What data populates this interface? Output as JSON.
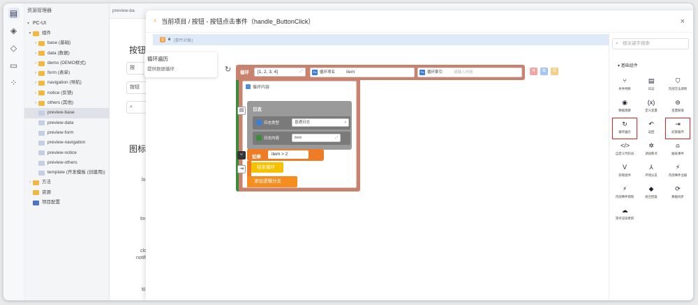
{
  "explorer": {
    "title": "资源管理器",
    "project": "PC-UI",
    "tree": [
      {
        "label": "组件",
        "type": "folder",
        "arrow": "▾",
        "indent": 1
      },
      {
        "label": "base (基础)",
        "type": "folder",
        "arrow": "›",
        "indent": 2
      },
      {
        "label": "data (数据)",
        "type": "folder",
        "arrow": "›",
        "indent": 2
      },
      {
        "label": "demo (DEMO样式)",
        "type": "folder",
        "arrow": "›",
        "indent": 2
      },
      {
        "label": "form (表单)",
        "type": "folder",
        "arrow": "›",
        "indent": 2
      },
      {
        "label": "navigation (导航)",
        "type": "folder",
        "arrow": "›",
        "indent": 2
      },
      {
        "label": "notice (反馈)",
        "type": "folder",
        "arrow": "›",
        "indent": 2
      },
      {
        "label": "others (其他)",
        "type": "folder",
        "arrow": "›",
        "indent": 2
      },
      {
        "label": "preview-base",
        "type": "file",
        "arrow": "",
        "indent": 2,
        "selected": true
      },
      {
        "label": "preview-data",
        "type": "file",
        "arrow": "",
        "indent": 2
      },
      {
        "label": "preview-form",
        "type": "file",
        "arrow": "",
        "indent": 2
      },
      {
        "label": "preview-navigation",
        "type": "file",
        "arrow": "",
        "indent": 2
      },
      {
        "label": "preview-notice",
        "type": "file",
        "arrow": "",
        "indent": 2
      },
      {
        "label": "preview-others",
        "type": "file",
        "arrow": "",
        "indent": 2
      },
      {
        "label": "template (开发模板 (创建用))",
        "type": "file",
        "arrow": "",
        "indent": 2
      },
      {
        "label": "方法",
        "type": "folder",
        "arrow": "›",
        "indent": 1
      },
      {
        "label": "资源",
        "type": "folder",
        "arrow": "",
        "indent": 1
      },
      {
        "label": "项目配置",
        "type": "cfg",
        "arrow": "",
        "indent": 1
      }
    ]
  },
  "editor": {
    "tab": "preview-ba",
    "heading1": "按钮",
    "box1": "按",
    "box2": "按钮",
    "heading2": "图标",
    "items": [
      "lo",
      "tin",
      "clo",
      "notifi",
      "fil"
    ]
  },
  "modal": {
    "title": "当前项目 / 按钮 - 按钮点击事件（handle_ButtonClick）",
    "close": "×",
    "param": {
      "icon": "{}",
      "name": "e",
      "desc": "(事件对象)"
    }
  },
  "tooltip": {
    "title": "循环遍历",
    "desc": "提供数据循环"
  },
  "loop": {
    "label": "循环",
    "array_value": "[1, 2, 3, 4]",
    "item_label": "循环项名",
    "item_value": "item",
    "index_label": "循环索引",
    "index_placeholder": "请输入内容",
    "body_title": "循环内容"
  },
  "log": {
    "label": "日志",
    "type_label": "日志类型",
    "type_value": "普通日志",
    "content_label": "日志内容",
    "content_value": "item"
  },
  "if_block": {
    "label": "如果",
    "condition": "item > 2",
    "break_label": "结束循环",
    "add_branch": "添加逻辑分支"
  },
  "panel": {
    "search_placeholder": "搜关键字搜索",
    "section": "基础组件",
    "items": [
      {
        "label": "条件判断",
        "icon": "⑂"
      },
      {
        "label": "日志",
        "icon": "▤"
      },
      {
        "label": "内部方法调用",
        "icon": "⛉"
      },
      {
        "label": "数据观察",
        "icon": "◉"
      },
      {
        "label": "定义变量",
        "icon": "(x)"
      },
      {
        "label": "变量赋值",
        "icon": "⊜"
      },
      {
        "label": "循环遍历",
        "icon": "↻",
        "highlight": true
      },
      {
        "label": "返回",
        "icon": "↶"
      },
      {
        "label": "结束循环",
        "icon": "⇥",
        "highlight": true
      },
      {
        "label": "自定义代码块",
        "icon": "</>"
      },
      {
        "label": "调试断点",
        "icon": "✲"
      },
      {
        "label": "触发事件",
        "icon": "⍝"
      },
      {
        "label": "获取组件",
        "icon": "V"
      },
      {
        "label": "环境分支",
        "icon": "⅄"
      },
      {
        "label": "内部事件注册",
        "icon": "⚡"
      },
      {
        "label": "内部事件销毁",
        "icon": "⚡"
      },
      {
        "label": "组合回复",
        "icon": "◆"
      },
      {
        "label": "数据同步",
        "icon": "⟳"
      },
      {
        "label": "等待渲染更新",
        "icon": "☁"
      }
    ]
  },
  "colors": {
    "loop": "#c8826d",
    "if": "#ee7c27",
    "break": "#f5c200",
    "highlight": "#e02020"
  }
}
